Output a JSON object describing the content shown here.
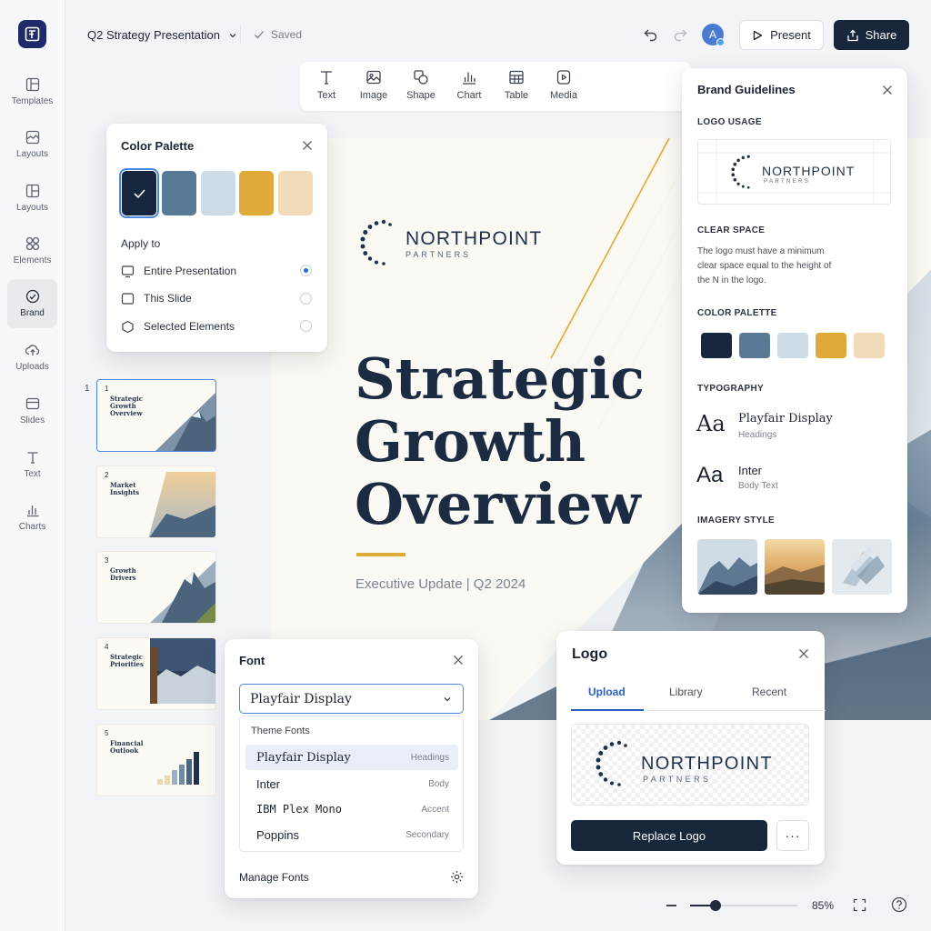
{
  "app": {
    "doc_title": "Q2 Strategy Presentation",
    "save_status": "Saved",
    "avatar_initial": "A",
    "present_label": "Present",
    "share_label": "Share"
  },
  "sidebar": {
    "items": [
      {
        "label": "Templates",
        "icon": "templates-icon"
      },
      {
        "label": "Layouts",
        "icon": "layouts-icon"
      },
      {
        "label": "Layouts",
        "icon": "layouts-icon"
      },
      {
        "label": "Elements",
        "icon": "elements-icon"
      },
      {
        "label": "Brand",
        "icon": "brand-icon",
        "active": true
      },
      {
        "label": "Uploads",
        "icon": "upload-icon"
      },
      {
        "label": "Slides",
        "icon": "slides-icon"
      },
      {
        "label": "Text",
        "icon": "text-icon"
      },
      {
        "label": "Charts",
        "icon": "chart-icon"
      }
    ]
  },
  "toolbar": {
    "items": [
      {
        "label": "Text",
        "icon": "text-icon"
      },
      {
        "label": "Image",
        "icon": "image-icon"
      },
      {
        "label": "Shape",
        "icon": "shape-icon"
      },
      {
        "label": "Chart",
        "icon": "chart-icon"
      },
      {
        "label": "Table",
        "icon": "table-icon"
      },
      {
        "label": "Media",
        "icon": "media-icon"
      }
    ]
  },
  "slide": {
    "logo_wordmark": "NORTHPOINT",
    "logo_sub": "PARTNERS",
    "title_lines": [
      "Strategic",
      "Growth",
      "Overview"
    ],
    "subtitle": "Executive Update | Q2 2024"
  },
  "thumbnails": [
    {
      "num": "1",
      "title": "Strategic Growth Overview",
      "selected": true
    },
    {
      "num": "2",
      "title": "Market Insights"
    },
    {
      "num": "3",
      "title": "Growth Drivers"
    },
    {
      "num": "4",
      "title": "Strategic Priorities"
    },
    {
      "num": "5",
      "title": "Financial Outlook"
    }
  ],
  "color_palette_panel": {
    "title": "Color Palette",
    "colors": [
      "#16263d",
      "#587a97",
      "#cddce7",
      "#e0aa3a",
      "#f2dbb8"
    ],
    "selected_index": 0,
    "apply_to_label": "Apply to",
    "options": [
      {
        "label": "Entire Presentation",
        "selected": true
      },
      {
        "label": "This Slide",
        "selected": false
      },
      {
        "label": "Selected Elements",
        "selected": false
      }
    ]
  },
  "brand_panel": {
    "title": "Brand Guidelines",
    "logo_usage_label": "LOGO USAGE",
    "clear_space_label": "CLEAR SPACE",
    "clear_space_text": [
      "The logo must have a minimum",
      "clear space equal to the height of",
      "the N in the logo."
    ],
    "color_palette_label": "COLOR PALETTE",
    "colors": [
      "#16263d",
      "#587a97",
      "#cddce7",
      "#e0aa3a",
      "#f2dbb8"
    ],
    "typography_label": "TYPOGRAPHY",
    "fonts": [
      {
        "sample": "Aa",
        "name": "Playfair Display",
        "role": "Headings"
      },
      {
        "sample": "Aa",
        "name": "Inter",
        "role": "Body Text"
      }
    ],
    "imagery_label": "IMAGERY STYLE"
  },
  "font_panel": {
    "title": "Font",
    "selected_font": "Playfair Display",
    "theme_fonts_label": "Theme Fonts",
    "fonts": [
      {
        "name": "Playfair Display",
        "role": "Headings",
        "highlighted": true
      },
      {
        "name": "Inter",
        "role": "Body"
      },
      {
        "name": "IBM Plex Mono",
        "role": "Accent"
      },
      {
        "name": "Poppins",
        "role": "Secondary"
      }
    ],
    "manage_label": "Manage Fonts"
  },
  "logo_panel": {
    "title": "Logo",
    "tabs": [
      "Upload",
      "Library",
      "Recent"
    ],
    "active_tab": "Upload",
    "replace_label": "Replace Logo",
    "more_label": "···"
  },
  "zoom": {
    "value": 0.24,
    "label": "85%"
  },
  "colors": {
    "navy": "#17263a",
    "accent_blue": "#2a5fc4",
    "gold": "#e0ac38"
  }
}
